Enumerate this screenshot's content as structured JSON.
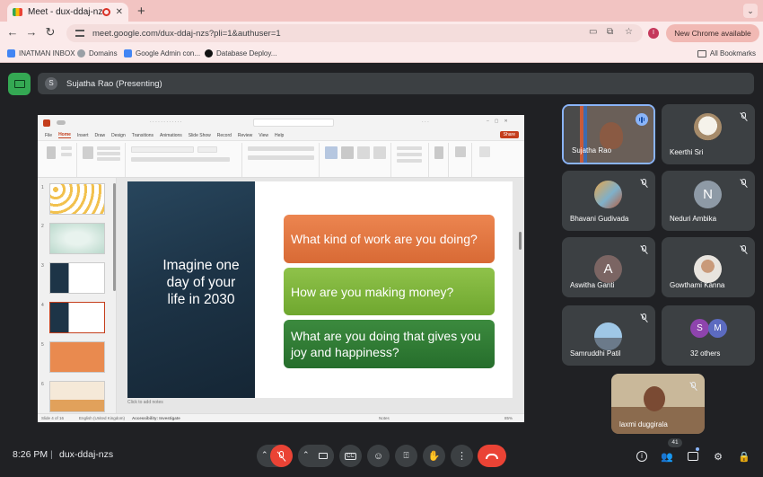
{
  "browser": {
    "tab_title": "Meet - dux-ddaj-nzs",
    "url": "meet.google.com/dux-ddaj-nzs?pli=1&authuser=1",
    "profile_initial": "I",
    "new_chrome_label": "New Chrome available",
    "bookmarks": [
      "INATMAN INBOX",
      "Domains",
      "Google Admin con...",
      "Database Deploy..."
    ],
    "all_bookmarks_label": "All Bookmarks"
  },
  "meet": {
    "presenter_initial": "S",
    "presenter_label": "Sujatha Rao (Presenting)",
    "time": "8:26 PM",
    "separator": "|",
    "meeting_code": "dux-ddaj-nzs",
    "participant_count": "41"
  },
  "presentation": {
    "ribbon_tabs": [
      "File",
      "Home",
      "Insert",
      "Draw",
      "Design",
      "Transitions",
      "Animations",
      "Slide Show",
      "Record",
      "Review",
      "View",
      "Help"
    ],
    "share_label": "Share",
    "slide_title": "Imagine one day of your life in 2030",
    "questions": [
      "What kind of work are you doing?",
      "How are you making money?",
      "What are you doing that gives you joy and happiness?"
    ],
    "notes_placeholder": "Click to add notes",
    "thumbnail_numbers": [
      "1",
      "2",
      "3",
      "4",
      "5",
      "6"
    ],
    "status_slide": "Slide 4 of 16",
    "status_lang": "English (United Kingdom)",
    "status_access": "Accessibility: Investigate",
    "status_notes": "Notes",
    "status_zoom": "85%"
  },
  "participants": [
    {
      "name": "Sujatha Rao",
      "speaking": true
    },
    {
      "name": "Keerthi Sri",
      "muted": true
    },
    {
      "name": "Bhavani Gudivada",
      "muted": true
    },
    {
      "name": "Neduri Ambika",
      "initial": "N",
      "muted": true
    },
    {
      "name": "Aswitha Ganti",
      "initial": "A",
      "muted": true
    },
    {
      "name": "Gowthami Kanna",
      "muted": true
    },
    {
      "name": "Samruddhi Patil",
      "muted": true
    },
    {
      "name": "32 others",
      "initials": [
        "S",
        "M"
      ]
    },
    {
      "name": "laxmi duggirala",
      "muted": true
    }
  ],
  "colors": {
    "meet_bg": "#202124",
    "tile_bg": "#3c4043",
    "end_call": "#ea4335",
    "card_orange": "#e07b45",
    "card_lightgreen": "#7fb23b",
    "card_darkgreen": "#2f7d34"
  },
  "icons": [
    "layout-icon",
    "mic-off-icon",
    "camera-icon",
    "captions-icon",
    "emoji-icon",
    "present-icon",
    "raise-hand-icon",
    "more-icon",
    "end-call-icon",
    "info-icon",
    "people-icon",
    "chat-icon",
    "activities-icon",
    "host-controls-icon"
  ]
}
